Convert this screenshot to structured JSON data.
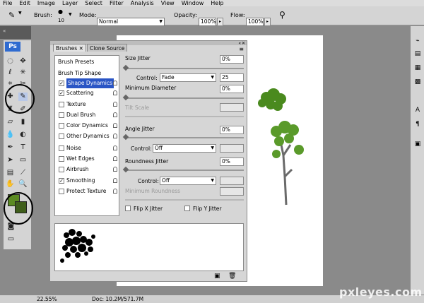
{
  "menu": [
    "File",
    "Edit",
    "Image",
    "Layer",
    "Select",
    "Filter",
    "Analysis",
    "View",
    "Window",
    "Help"
  ],
  "options": {
    "brush_label": "Brush:",
    "brush_size": "10",
    "mode_label": "Mode:",
    "mode_value": "Normal",
    "opacity_label": "Opacity:",
    "opacity_value": "100%",
    "flow_label": "Flow:",
    "flow_value": "100%"
  },
  "tools": {
    "logo": "Ps",
    "fg_color": "#5b8a22",
    "bg_color": "#3f5e1b"
  },
  "panel": {
    "tabs": [
      "Brushes",
      "Clone Source"
    ],
    "list": [
      {
        "label": "Brush Presets",
        "checkbox": false,
        "lock": false
      },
      {
        "label": "Brush Tip Shape",
        "checkbox": false,
        "lock": false
      },
      {
        "label": "Shape Dynamics",
        "checkbox": true,
        "checked": true,
        "lock": true,
        "selected": true
      },
      {
        "label": "Scattering",
        "checkbox": true,
        "checked": true,
        "lock": true
      },
      {
        "label": "Texture",
        "checkbox": true,
        "checked": false,
        "lock": true
      },
      {
        "label": "Dual Brush",
        "checkbox": true,
        "checked": false,
        "lock": true
      },
      {
        "label": "Color Dynamics",
        "checkbox": true,
        "checked": false,
        "lock": true
      },
      {
        "label": "Other Dynamics",
        "checkbox": true,
        "checked": false,
        "lock": true
      },
      {
        "label": "Noise",
        "checkbox": true,
        "checked": false,
        "lock": true
      },
      {
        "label": "Wet Edges",
        "checkbox": true,
        "checked": false,
        "lock": true
      },
      {
        "label": "Airbrush",
        "checkbox": true,
        "checked": false,
        "lock": true
      },
      {
        "label": "Smoothing",
        "checkbox": true,
        "checked": true,
        "lock": true
      },
      {
        "label": "Protect Texture",
        "checkbox": true,
        "checked": false,
        "lock": true
      }
    ],
    "size_jitter_label": "Size Jitter",
    "size_jitter_value": "0%",
    "control_label": "Control:",
    "control1_value": "Fade",
    "control1_steps": "25",
    "min_diameter_label": "Minimum Diameter",
    "min_diameter_value": "0%",
    "tilt_scale_label": "Tilt Scale",
    "angle_jitter_label": "Angle Jitter",
    "angle_jitter_value": "0%",
    "control2_value": "Off",
    "roundness_jitter_label": "Roundness Jitter",
    "roundness_jitter_value": "0%",
    "control3_value": "Off",
    "min_roundness_label": "Minimum Roundness",
    "flip_x_label": "Flip X Jitter",
    "flip_y_label": "Flip Y Jitter"
  },
  "status": {
    "zoom": "22.55%",
    "doc": "Doc: 10.2M/571.7M"
  },
  "watermark": "pxleyes.com"
}
